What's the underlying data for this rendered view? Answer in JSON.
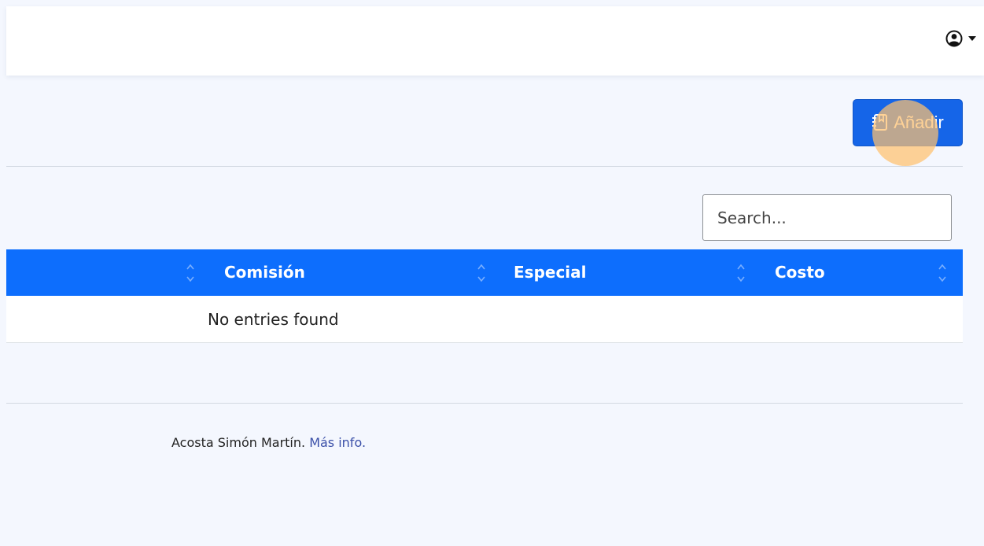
{
  "header": {
    "user_icon": "user-circle-icon",
    "dropdown_icon": "caret-down-icon"
  },
  "toolbar": {
    "add_label": "Añadir",
    "add_icon": "notebook-icon",
    "accent_color": "#1565e8"
  },
  "search": {
    "placeholder": "Search...",
    "value": ""
  },
  "table": {
    "header_color": "#0d6efd",
    "columns": [
      "Comisión",
      "Especial",
      "Costo"
    ],
    "sort_icon": "sort-icon",
    "empty_message": "No entries found"
  },
  "footer": {
    "author": "Acosta Simón Martín.",
    "link_label": "Más info."
  }
}
